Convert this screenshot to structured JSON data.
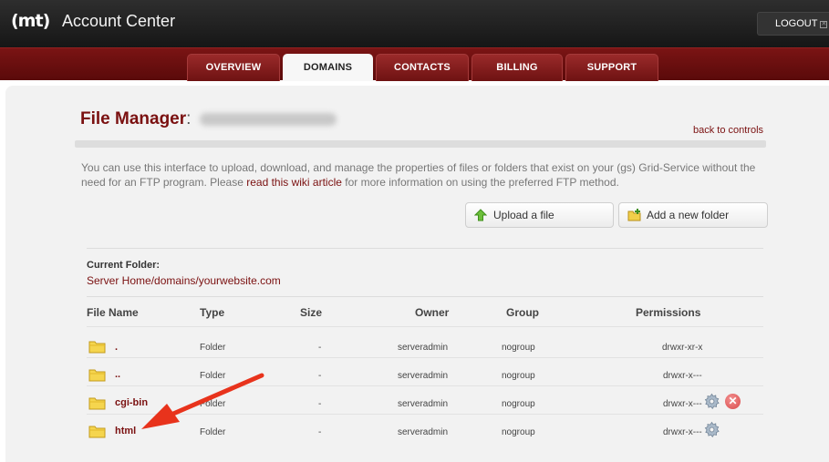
{
  "header": {
    "logo": "(mt)",
    "title": "Account Center",
    "logout_label": "LOGOUT",
    "logout_icon": "close-icon"
  },
  "nav": {
    "tabs": [
      {
        "label": "OVERVIEW",
        "active": false
      },
      {
        "label": "DOMAINS",
        "active": true
      },
      {
        "label": "CONTACTS",
        "active": false
      },
      {
        "label": "BILLING",
        "active": false
      },
      {
        "label": "SUPPORT",
        "active": false
      }
    ]
  },
  "page": {
    "title": "File Manager",
    "title_colon": ":",
    "back_link": "back to controls",
    "description_pre": "You can use this interface to upload, download, and manage the properties of files or folders that exist on your (gs) Grid-Service without the need for an FTP program. Please ",
    "description_link": "read this wiki article",
    "description_post": " for more information on using the preferred FTP method."
  },
  "actions": {
    "upload_label": "Upload a file",
    "upload_icon": "upload-arrow-icon",
    "add_folder_label": "Add a new folder",
    "add_folder_icon": "add-folder-icon"
  },
  "current_folder": {
    "label": "Current Folder:",
    "path": "Server Home/domains/yourwebsite.com"
  },
  "table": {
    "headers": {
      "name": "File Name",
      "type": "Type",
      "size": "Size",
      "owner": "Owner",
      "group": "Group",
      "permissions": "Permissions"
    },
    "rows": [
      {
        "name": ".",
        "type": "Folder",
        "size": "-",
        "owner": "serveradmin",
        "group": "nogroup",
        "permissions": "drwxr-xr-x"
      },
      {
        "name": "..",
        "type": "Folder",
        "size": "-",
        "owner": "serveradmin",
        "group": "nogroup",
        "permissions": "drwxr-x---"
      },
      {
        "name": "cgi-bin",
        "type": "Folder",
        "size": "-",
        "owner": "serveradmin",
        "group": "nogroup",
        "permissions": "drwxr-x---"
      },
      {
        "name": "html",
        "type": "Folder",
        "size": "-",
        "owner": "serveradmin",
        "group": "nogroup",
        "permissions": "drwxr-x---"
      }
    ]
  },
  "colors": {
    "brand_red": "#7a1010",
    "nav_red": "#6a1010",
    "topbar": "#1e1e1e",
    "panel_bg": "#f2f2f2",
    "annotation_arrow": "#e8331c"
  },
  "icons": {
    "folder": "folder-icon",
    "settings": "gear-icon",
    "delete": "delete-icon"
  }
}
